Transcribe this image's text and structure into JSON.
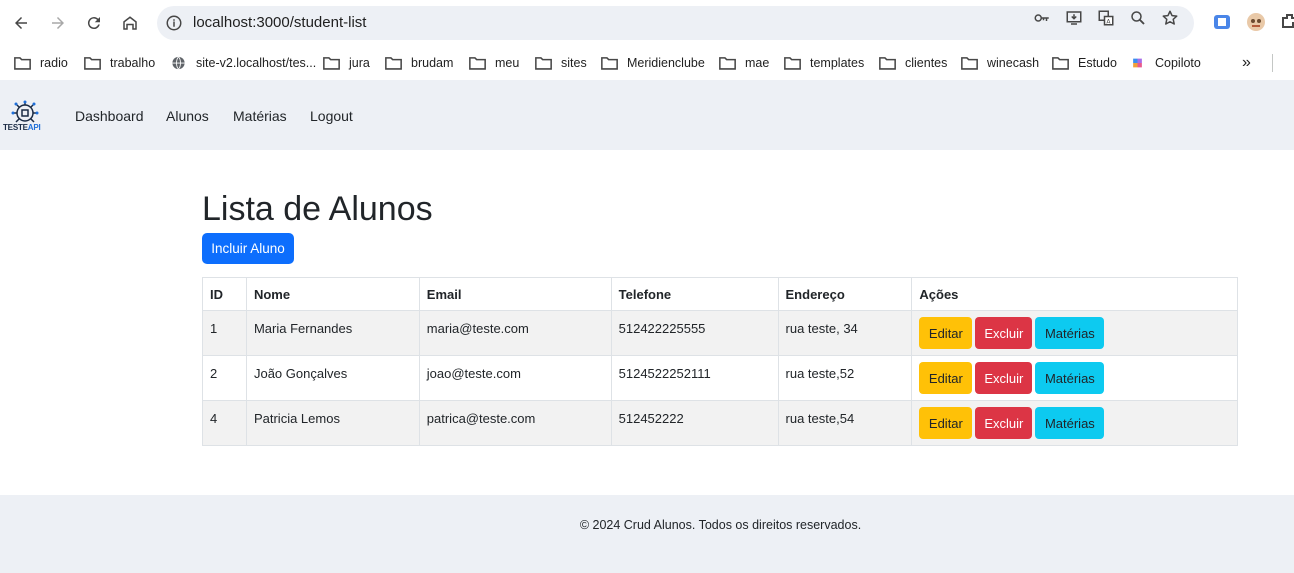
{
  "browser": {
    "url": "localhost:3000/student-list",
    "bookmarks": [
      {
        "label": "radio",
        "icon": "folder-icon"
      },
      {
        "label": "trabalho",
        "icon": "folder-icon"
      },
      {
        "label": "site-v2.localhost/tes...",
        "icon": "globe-icon"
      },
      {
        "label": "jura",
        "icon": "folder-icon"
      },
      {
        "label": "brudam",
        "icon": "folder-icon"
      },
      {
        "label": "meu",
        "icon": "folder-icon"
      },
      {
        "label": "sites",
        "icon": "folder-icon"
      },
      {
        "label": "Meridienclube",
        "icon": "folder-icon"
      },
      {
        "label": "mae",
        "icon": "folder-icon"
      },
      {
        "label": "templates",
        "icon": "folder-icon"
      },
      {
        "label": "clientes",
        "icon": "folder-icon"
      },
      {
        "label": "winecash",
        "icon": "folder-icon"
      },
      {
        "label": "Estudo",
        "icon": "folder-icon"
      },
      {
        "label": "Copiloto",
        "icon": "copilot-icon"
      }
    ]
  },
  "navbar": {
    "logo_text": "TESTE",
    "logo_accent": "API",
    "links": [
      "Dashboard",
      "Alunos",
      "Matérias",
      "Logout"
    ]
  },
  "main": {
    "title": "Lista de Alunos",
    "add_button": "Incluir Aluno",
    "columns": [
      "ID",
      "Nome",
      "Email",
      "Telefone",
      "Endereço",
      "Ações"
    ],
    "rows": [
      {
        "id": "1",
        "nome": "Maria Fernandes",
        "email": "maria@teste.com",
        "telefone": "512422225555",
        "endereco": "rua teste, 34"
      },
      {
        "id": "2",
        "nome": "João Gonçalves",
        "email": "joao@teste.com",
        "telefone": "5124522252111",
        "endereco": "rua teste,52"
      },
      {
        "id": "4",
        "nome": "Patricia Lemos",
        "email": "patrica@teste.com",
        "telefone": "512452222",
        "endereco": "rua teste,54"
      }
    ],
    "actions": {
      "edit": "Editar",
      "delete": "Excluir",
      "subjects": "Matérias"
    }
  },
  "footer": {
    "text": "© 2024 Crud Alunos. Todos os direitos reservados."
  },
  "colors": {
    "primary": "#0d6efd",
    "warning": "#ffc107",
    "danger": "#dc3545",
    "info": "#0dcaf0",
    "navbar_bg": "#edf0f5"
  }
}
